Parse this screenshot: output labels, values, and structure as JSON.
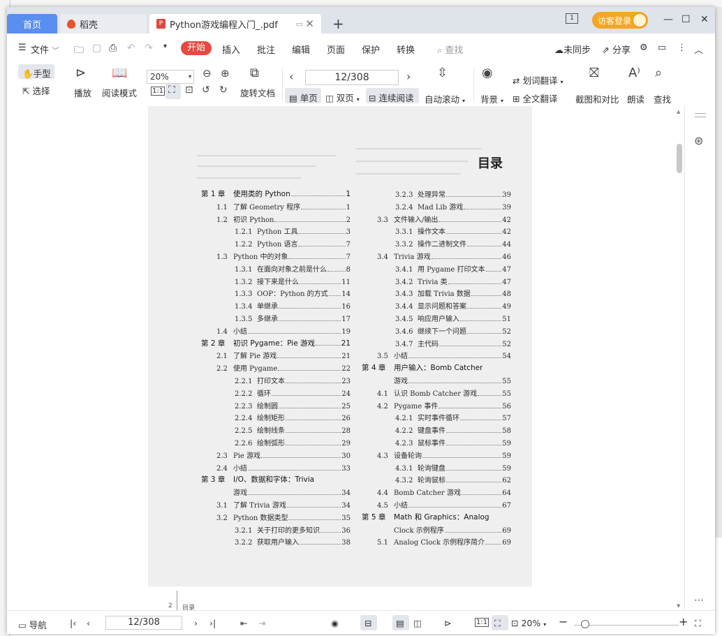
{
  "tabs": {
    "home": "首页",
    "daoke": "稻壳",
    "doc": "Python游戏编程入门_.pdf",
    "new": "+"
  },
  "titlebar": {
    "login": "访客登录",
    "page_badge": "1"
  },
  "menu": {
    "file": "文件",
    "start": "开始",
    "insert": "插入",
    "annotate": "批注",
    "edit": "编辑",
    "page": "页面",
    "protect": "保护",
    "convert": "转换",
    "search": "查找",
    "unsync": "未同步",
    "share": "分享"
  },
  "ribbon": {
    "hand": "手型",
    "select": "选择",
    "play": "播放",
    "read_mode": "阅读模式",
    "zoom": "20%",
    "rotate": "旋转文档",
    "page_input": "12/308",
    "single": "单页",
    "double": "双页",
    "continuous": "连续阅读",
    "auto_scroll": "自动滚动",
    "background": "背景",
    "word_translate": "划词翻译",
    "full_translate": "全文翻译",
    "screenshot_compare": "截图和对比",
    "read_aloud": "朗读",
    "find": "查找"
  },
  "document": {
    "toc_title": "目录",
    "page_number": "2",
    "running_head": "目录",
    "left_column": [
      {
        "type": "ch",
        "num": "第 1 章",
        "title": "使用类的 Python",
        "page": "1"
      },
      {
        "type": "l1",
        "num": "1.1",
        "title": "了解 Geometry 程序",
        "page": "1"
      },
      {
        "type": "l1",
        "num": "1.2",
        "title": "初识 Python",
        "page": "2"
      },
      {
        "type": "l2",
        "num": "1.2.1",
        "title": "Python 工具",
        "page": "3"
      },
      {
        "type": "l2",
        "num": "1.2.2",
        "title": "Python 语言",
        "page": "7"
      },
      {
        "type": "l1",
        "num": "1.3",
        "title": "Python 中的对象",
        "page": "7"
      },
      {
        "type": "l2",
        "num": "1.3.1",
        "title": "在面向对象之前是什么",
        "page": "8"
      },
      {
        "type": "l2",
        "num": "1.3.2",
        "title": "接下来是什么",
        "page": "11"
      },
      {
        "type": "l2",
        "num": "1.3.3",
        "title": "OOP：Python 的方式",
        "page": "14"
      },
      {
        "type": "l2",
        "num": "1.3.4",
        "title": "单继承",
        "page": "16"
      },
      {
        "type": "l2",
        "num": "1.3.5",
        "title": "多继承",
        "page": "17"
      },
      {
        "type": "l1",
        "num": "1.4",
        "title": "小结",
        "page": "19"
      },
      {
        "type": "ch",
        "num": "第 2 章",
        "title": "初识 Pygame：Pie 游戏",
        "page": "21"
      },
      {
        "type": "l1",
        "num": "2.1",
        "title": "了解 Pie 游戏",
        "page": "21"
      },
      {
        "type": "l1",
        "num": "2.2",
        "title": "使用 Pygame",
        "page": "22"
      },
      {
        "type": "l2",
        "num": "2.2.1",
        "title": "打印文本",
        "page": "23"
      },
      {
        "type": "l2",
        "num": "2.2.2",
        "title": "循环",
        "page": "24"
      },
      {
        "type": "l2",
        "num": "2.2.3",
        "title": "绘制圆",
        "page": "25"
      },
      {
        "type": "l2",
        "num": "2.2.4",
        "title": "绘制矩形",
        "page": "26"
      },
      {
        "type": "l2",
        "num": "2.2.5",
        "title": "绘制线条",
        "page": "28"
      },
      {
        "type": "l2",
        "num": "2.2.6",
        "title": "绘制弧形",
        "page": "29"
      },
      {
        "type": "l1",
        "num": "2.3",
        "title": "Pie 游戏",
        "page": "30"
      },
      {
        "type": "l1",
        "num": "2.4",
        "title": "小结",
        "page": "33"
      },
      {
        "type": "ch",
        "num": "第 3 章",
        "title": "I/O、数据和字体：Trivia",
        "page": ""
      },
      {
        "type": "cont",
        "num": "",
        "title": "游戏",
        "page": "34"
      },
      {
        "type": "l1",
        "num": "3.1",
        "title": "了解 Trivia 游戏",
        "page": "34"
      },
      {
        "type": "l1",
        "num": "3.2",
        "title": "Python 数据类型",
        "page": "35"
      },
      {
        "type": "l2",
        "num": "3.2.1",
        "title": "关于打印的更多知识",
        "page": "36"
      },
      {
        "type": "l2",
        "num": "3.2.2",
        "title": "获取用户输入",
        "page": "38"
      }
    ],
    "right_column": [
      {
        "type": "l2",
        "num": "3.2.3",
        "title": "处理异常",
        "page": "39"
      },
      {
        "type": "l2",
        "num": "3.2.4",
        "title": "Mad Lib 游戏",
        "page": "39"
      },
      {
        "type": "l1",
        "num": "3.3",
        "title": "文件输入/输出",
        "page": "42"
      },
      {
        "type": "l2",
        "num": "3.3.1",
        "title": "操作文本",
        "page": "42"
      },
      {
        "type": "l2",
        "num": "3.3.2",
        "title": "操作二进制文件",
        "page": "44"
      },
      {
        "type": "l1",
        "num": "3.4",
        "title": "Trivia 游戏",
        "page": "46"
      },
      {
        "type": "l2",
        "num": "3.4.1",
        "title": "用 Pygame 打印文本",
        "page": "47"
      },
      {
        "type": "l2",
        "num": "3.4.2",
        "title": "Trivia 类",
        "page": "47"
      },
      {
        "type": "l2",
        "num": "3.4.3",
        "title": "加载 Trivia 数据",
        "page": "48"
      },
      {
        "type": "l2",
        "num": "3.4.4",
        "title": "显示问题和答案",
        "page": "49"
      },
      {
        "type": "l2",
        "num": "3.4.5",
        "title": "响应用户输入",
        "page": "51"
      },
      {
        "type": "l2",
        "num": "3.4.6",
        "title": "继续下一个问题",
        "page": "52"
      },
      {
        "type": "l2",
        "num": "3.4.7",
        "title": "主代码",
        "page": "52"
      },
      {
        "type": "l1",
        "num": "3.5",
        "title": "小结",
        "page": "54"
      },
      {
        "type": "ch",
        "num": "第 4 章",
        "title": "用户输入：Bomb Catcher",
        "page": ""
      },
      {
        "type": "cont",
        "num": "",
        "title": "游戏",
        "page": "55"
      },
      {
        "type": "l1",
        "num": "4.1",
        "title": "认识 Bomb Catcher 游戏",
        "page": "55"
      },
      {
        "type": "l1",
        "num": "4.2",
        "title": "Pygame 事件",
        "page": "56"
      },
      {
        "type": "l2",
        "num": "4.2.1",
        "title": "实时事件循环",
        "page": "57"
      },
      {
        "type": "l2",
        "num": "4.2.2",
        "title": "键盘事件",
        "page": "58"
      },
      {
        "type": "l2",
        "num": "4.2.3",
        "title": "鼠标事件",
        "page": "59"
      },
      {
        "type": "l1",
        "num": "4.3",
        "title": "设备轮询",
        "page": "59"
      },
      {
        "type": "l2",
        "num": "4.3.1",
        "title": "轮询键盘",
        "page": "59"
      },
      {
        "type": "l2",
        "num": "4.3.2",
        "title": "轮询鼠标",
        "page": "62"
      },
      {
        "type": "l1",
        "num": "4.4",
        "title": "Bomb Catcher 游戏",
        "page": "64"
      },
      {
        "type": "l1",
        "num": "4.5",
        "title": "小结",
        "page": "67"
      },
      {
        "type": "ch",
        "num": "第 5 章",
        "title": "Math 和 Graphics：Analog",
        "page": ""
      },
      {
        "type": "cont",
        "num": "",
        "title": "Clock 示例程序",
        "page": "69"
      },
      {
        "type": "l1",
        "num": "5.1",
        "title": "Analog Clock 示例程序简介",
        "page": "69"
      }
    ]
  },
  "status": {
    "nav": "导航",
    "page_input": "12/308",
    "zoom": "20%"
  },
  "colors": {
    "tab_active": "#5a8ef0",
    "start_button": "#e8483f",
    "login": "#f5a623"
  }
}
